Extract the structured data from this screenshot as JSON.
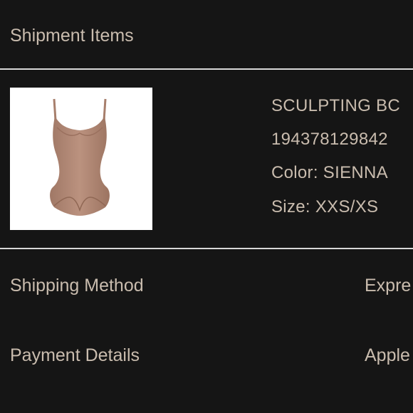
{
  "shipment_items": {
    "title": "Shipment Items"
  },
  "item": {
    "image_icon": "bodysuit-image",
    "name": "SCULPTING BC",
    "sku": "194378129842",
    "color": "Color: SIENNA",
    "size": "Size: XXS/XS",
    "product_color": "#b48a76"
  },
  "shipping": {
    "label": "Shipping Method",
    "value": "Expre"
  },
  "payment": {
    "label": "Payment Details",
    "value": "Apple"
  }
}
